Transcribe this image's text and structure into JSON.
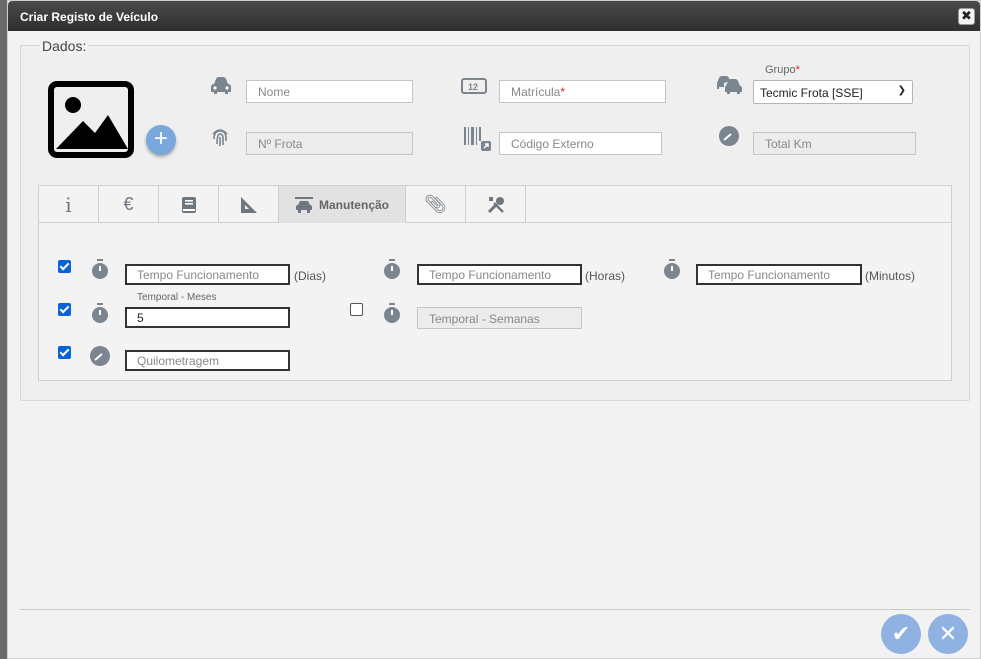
{
  "dialog": {
    "title": "Criar Registo de Veículo",
    "close_glyph": "✖"
  },
  "dados": {
    "legend": "Dados:",
    "nome_placeholder": "Nome",
    "matricula_placeholder": "Matrícula",
    "matricula_required": "*",
    "grupo_label": "Grupo",
    "grupo_required": "*",
    "grupo_value": "Tecmic Frota [SSE]",
    "nfrota_placeholder": "Nº Frota",
    "codigo_placeholder": "Código Externo",
    "totalkm_placeholder": "Total Km",
    "add_photo_glyph": "+"
  },
  "tabs": [
    {
      "icon": "info-icon",
      "label": ""
    },
    {
      "icon": "euro-icon",
      "label": ""
    },
    {
      "icon": "book-icon",
      "label": ""
    },
    {
      "icon": "ruler-icon",
      "label": ""
    },
    {
      "icon": "car-lift-icon",
      "label": "Manutenção"
    },
    {
      "icon": "paperclip-icon",
      "label": ""
    },
    {
      "icon": "tools-icon",
      "label": ""
    }
  ],
  "manutencao": {
    "row1": {
      "dias_placeholder": "Tempo Funcionamento",
      "dias_unit": "(Dias)",
      "horas_placeholder": "Tempo Funcionamento",
      "horas_unit": "(Horas)",
      "minutos_placeholder": "Tempo Funcionamento",
      "minutos_unit": "(Minutos)"
    },
    "row2": {
      "meses_label": "Temporal - Meses",
      "meses_value": "5",
      "semanas_placeholder": "Temporal - Semanas"
    },
    "row3": {
      "km_placeholder": "Quilometragem"
    }
  },
  "footer": {
    "confirm_glyph": "✔",
    "cancel_glyph": "✕"
  },
  "colors": {
    "accent": "#8fb2e3",
    "checkbox": "#0a63d6",
    "icon": "#7a8590"
  }
}
